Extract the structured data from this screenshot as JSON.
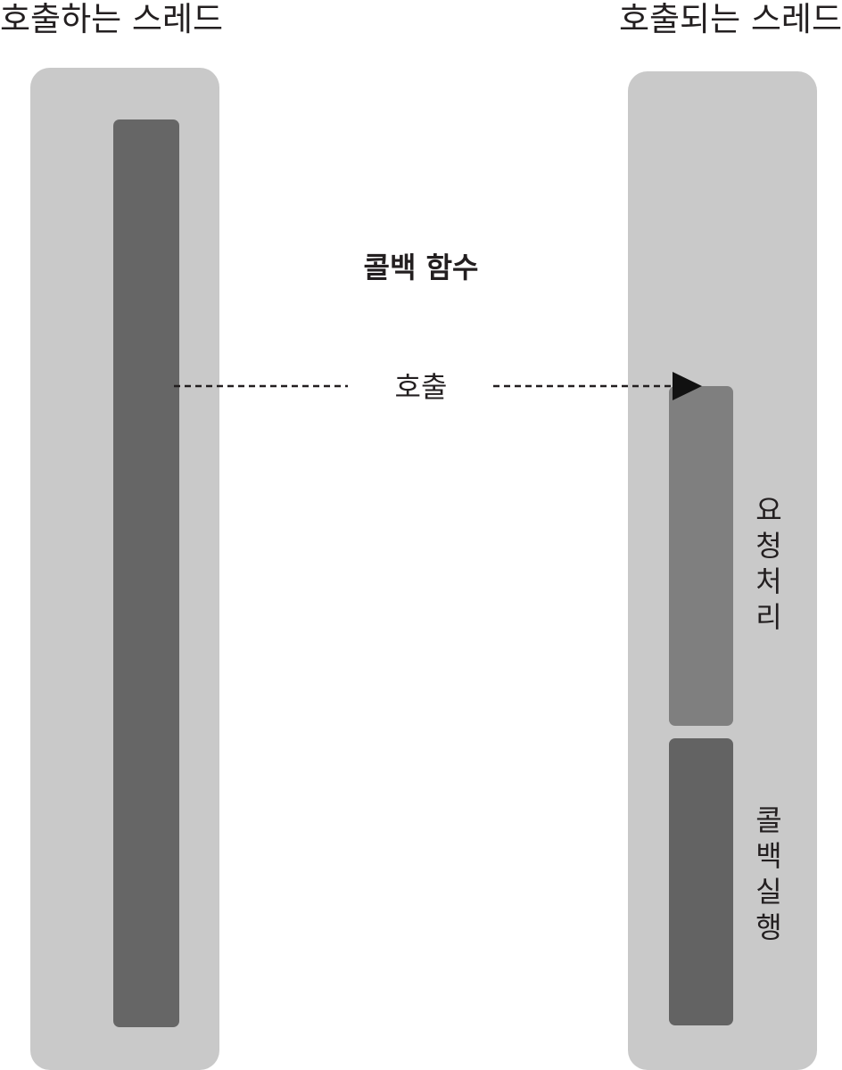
{
  "headings": {
    "caller": "호출하는 스레드",
    "callee": "호출되는 스레드"
  },
  "labels": {
    "callback_function": "콜백 함수",
    "call": "호출",
    "request_processing": "요청 처리",
    "callback_execution": "콜백 실행"
  },
  "colors": {
    "lane": "#c9c9c9",
    "caller_bar": "#666666",
    "request_bar": "#7f7f7f",
    "callback_bar": "#636363",
    "text": "#231f20"
  }
}
